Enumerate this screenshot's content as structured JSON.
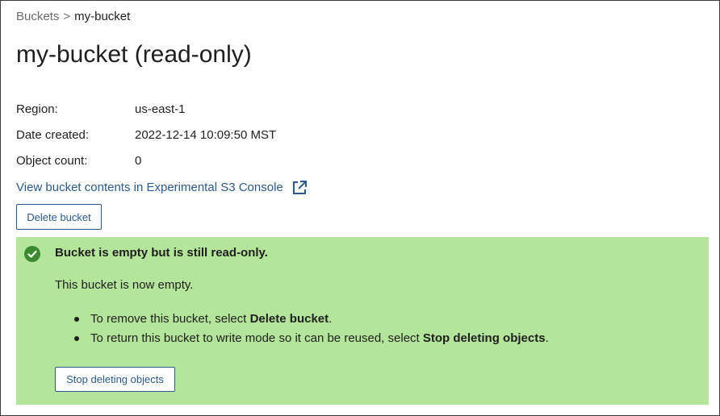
{
  "breadcrumb": {
    "parent": "Buckets",
    "separator": ">",
    "current": "my-bucket"
  },
  "page": {
    "title": "my-bucket (read-only)"
  },
  "details": [
    {
      "label": "Region:",
      "value": "us-east-1"
    },
    {
      "label": "Date created:",
      "value": "2022-12-14 10:09:50 MST"
    },
    {
      "label": "Object count:",
      "value": "0"
    }
  ],
  "console_link": {
    "label": "View bucket contents in Experimental S3 Console",
    "icon": "external-link-icon"
  },
  "actions": {
    "delete_label": "Delete bucket"
  },
  "alert": {
    "icon": "check-circle-icon",
    "title": "Bucket is empty but is still read-only.",
    "body": "This bucket is now empty.",
    "items": [
      {
        "prefix": "To remove this bucket, select ",
        "bold": "Delete bucket",
        "suffix": "."
      },
      {
        "prefix": "To return this bucket to write mode so it can be reused, select ",
        "bold": "Stop deleting objects",
        "suffix": "."
      }
    ],
    "button_label": "Stop deleting objects"
  },
  "colors": {
    "link": "#2a5b8c",
    "alert_background": "#b3e59a",
    "success_icon": "#3c8a2e"
  }
}
